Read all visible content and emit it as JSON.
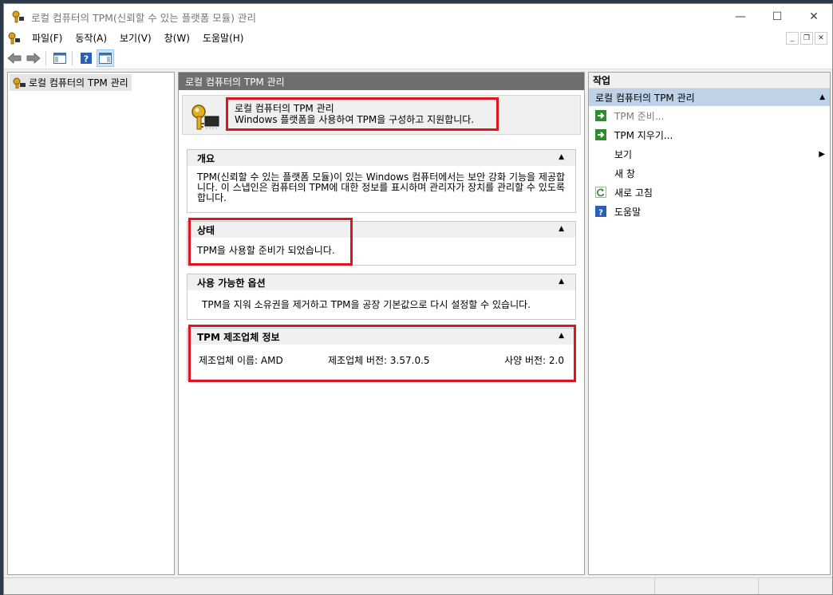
{
  "window": {
    "title": "로컬 컴퓨터의 TPM(신뢰할 수 있는 플랫폼 모듈) 관리",
    "controls": {
      "minimize": "—",
      "maximize": "☐",
      "close": "✕"
    }
  },
  "menu": {
    "items": [
      "파일(F)",
      "동작(A)",
      "보기(V)",
      "창(W)",
      "도움말(H)"
    ],
    "mdi": {
      "minimize": "_",
      "restore": "❐",
      "close": "✕"
    }
  },
  "tree": {
    "root_label": "로컬 컴퓨터의 TPM 관리"
  },
  "center": {
    "header": "로컬 컴퓨터의 TPM 관리",
    "banner": {
      "title": "로컬 컴퓨터의 TPM 관리",
      "subtitle": "Windows 플랫폼을 사용하여 TPM을 구성하고 지원합니다."
    },
    "overview": {
      "title": "개요",
      "body": "TPM(신뢰할 수 있는 플랫폼 모듈)이 있는 Windows 컴퓨터에서는 보안 강화 기능을 제공합니다. 이 스냅인은 컴퓨터의 TPM에 대한 정보를 표시하며 관리자가 장치를 관리할 수 있도록 합니다."
    },
    "status": {
      "title": "상태",
      "body": "TPM을 사용할 준비가 되었습니다."
    },
    "options": {
      "title": "사용 가능한 옵션",
      "body": "TPM을 지워 소유권을 제거하고 TPM을 공장 기본값으로 다시 설정할 수 있습니다."
    },
    "manufacturer": {
      "title": "TPM 제조업체 정보",
      "name": "제조업체 이름: AMD",
      "version": "제조업체 버전: 3.57.0.5",
      "spec": "사양 버전: 2.0"
    },
    "caret": "▲"
  },
  "actions": {
    "title": "작업",
    "group": "로컬 컴퓨터의 TPM 관리",
    "items": [
      {
        "label": "TPM 준비...",
        "icon": "green-arrow-icon"
      },
      {
        "label": "TPM 지우기...",
        "icon": "green-arrow-icon"
      },
      {
        "label": "보기",
        "icon": ""
      },
      {
        "label": "새 창",
        "icon": ""
      },
      {
        "label": "새로 고침",
        "icon": "refresh-icon"
      },
      {
        "label": "도움말",
        "icon": "help-icon"
      }
    ]
  },
  "colors": {
    "highlight_red": "#e0141e",
    "actions_group_bg": "#bfd3e8",
    "center_header_bg": "#6e6e6e"
  }
}
